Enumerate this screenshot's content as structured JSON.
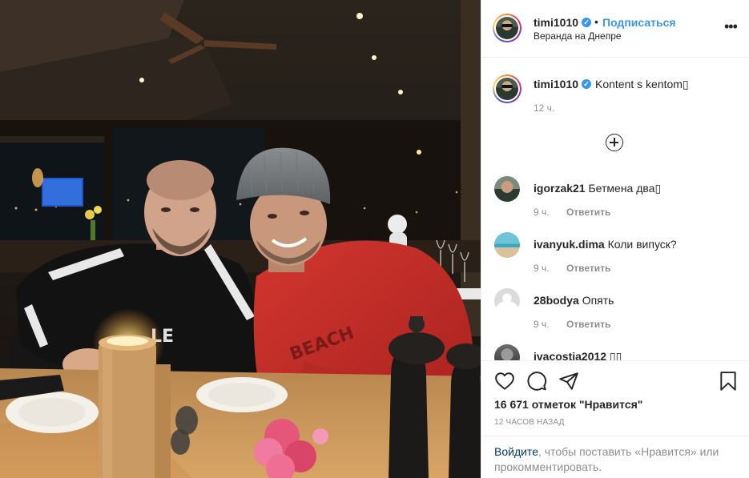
{
  "header": {
    "username": "timi1010",
    "verified_mark": "✓",
    "dot": "•",
    "follow_label": "Подписаться",
    "location": "Веранда на Днепре",
    "more_glyph": "•••"
  },
  "caption": {
    "username": "timi1010",
    "text": "Kontent s kentom▯",
    "time": "12 ч."
  },
  "comments": [
    {
      "username": "igorzak21",
      "text": "Бетмена два▯",
      "time": "9 ч.",
      "reply": "Ответить"
    },
    {
      "username": "ivanyuk.dima",
      "text": "Коли випуск?",
      "time": "9 ч.",
      "reply": "Ответить"
    },
    {
      "username": "28bodya",
      "text": "Опять",
      "time": "9 ч.",
      "reply": "Ответить"
    },
    {
      "username": "ivacostia2012",
      "text": "▯▯",
      "time": "",
      "reply": ""
    }
  ],
  "actions": {
    "icons": [
      "heart-icon",
      "comment-icon",
      "share-icon",
      "bookmark-icon"
    ],
    "likes": "16 671 отметок \"Нравится\"",
    "post_time": "12 ЧАСОВ НАЗАД"
  },
  "login": {
    "link": "Войдите",
    "text": ", чтобы поставить «Нравится» или прокомментировать."
  },
  "colors": {
    "accent": "#3897f0",
    "text": "#262626",
    "muted": "#8e8e8e",
    "link_dark": "#00376b"
  }
}
